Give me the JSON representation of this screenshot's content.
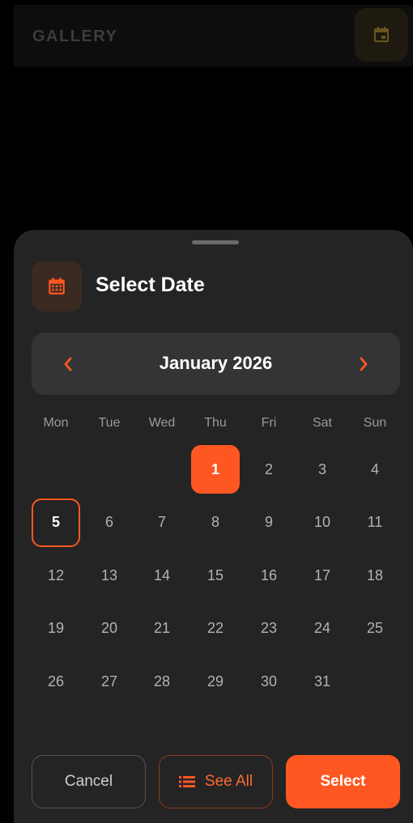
{
  "app": {
    "title": "GALLERY",
    "calendar_button_icon": "calendar-icon"
  },
  "sheet": {
    "title": "Select Date",
    "header_icon": "calendar-icon",
    "month_label": "January 2026",
    "prev_icon": "chevron-left-icon",
    "next_icon": "chevron-right-icon",
    "weekdays": [
      "Mon",
      "Tue",
      "Wed",
      "Thu",
      "Fri",
      "Sat",
      "Sun"
    ],
    "first_weekday_index": 3,
    "days_in_month": 31,
    "selected_day": 1,
    "today_day": 5,
    "buttons": {
      "cancel": "Cancel",
      "see_all": "See All",
      "see_all_icon": "list-icon",
      "select": "Select"
    }
  },
  "colors": {
    "accent": "#ff5722",
    "sheet_bg": "#242424",
    "month_bar_bg": "#343434"
  }
}
